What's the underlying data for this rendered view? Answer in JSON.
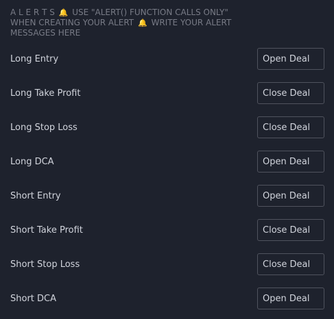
{
  "header": {
    "part1": "A L E R T S",
    "part2": "USE \"ALERT() FUNCTION CALLS ONLY\" WHEN CREATING YOUR ALERT",
    "part3": "WRITE YOUR ALERT MESSAGES HERE",
    "bell_icon": "bell-icon"
  },
  "rows": [
    {
      "label": "Long Entry",
      "value": "Open Deal"
    },
    {
      "label": "Long Take Profit",
      "value": "Close Deal"
    },
    {
      "label": "Long Stop Loss",
      "value": "Close Deal"
    },
    {
      "label": "Long DCA",
      "value": "Open Deal"
    },
    {
      "label": "Short Entry",
      "value": "Open Deal"
    },
    {
      "label": "Short Take Profit",
      "value": "Close Deal"
    },
    {
      "label": "Short Stop Loss",
      "value": "Close Deal"
    },
    {
      "label": "Short DCA",
      "value": "Open Deal"
    }
  ],
  "colors": {
    "background": "#1e222d",
    "label": "#d1d4dc",
    "header_text": "#787b86",
    "input_border": "#50535e",
    "bell": "#f5c518"
  }
}
